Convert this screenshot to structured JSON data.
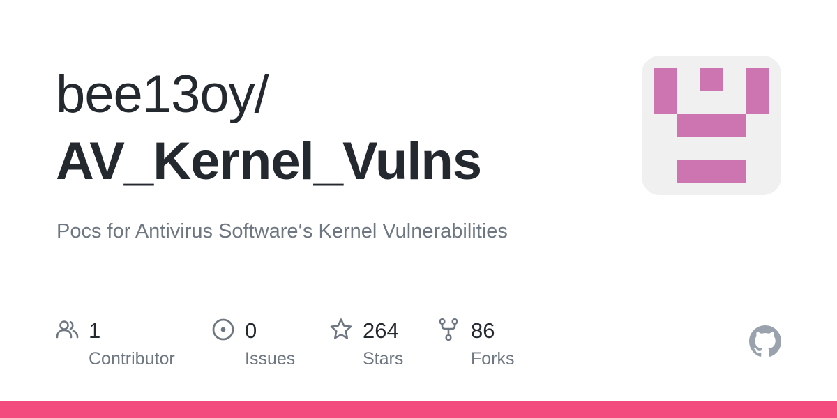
{
  "repo": {
    "owner": "bee13oy/",
    "name": "AV_Kernel_Vulns",
    "description": "Pocs for Antivirus Software‘s Kernel Vulnerabilities"
  },
  "stats": [
    {
      "value": "1",
      "label": "Contributor",
      "icon": "people-icon"
    },
    {
      "value": "0",
      "label": "Issues",
      "icon": "issue-opened-icon"
    },
    {
      "value": "264",
      "label": "Stars",
      "icon": "star-icon"
    },
    {
      "value": "86",
      "label": "Forks",
      "icon": "repo-forked-icon"
    }
  ],
  "colors": {
    "title": "#24292f",
    "muted": "#6e7781",
    "avatar_fill": "#cc75b0",
    "avatar_bg": "#f0f0f0",
    "language_bar": "#f34b7d"
  },
  "icons": {
    "brand": "github-mark-icon"
  }
}
